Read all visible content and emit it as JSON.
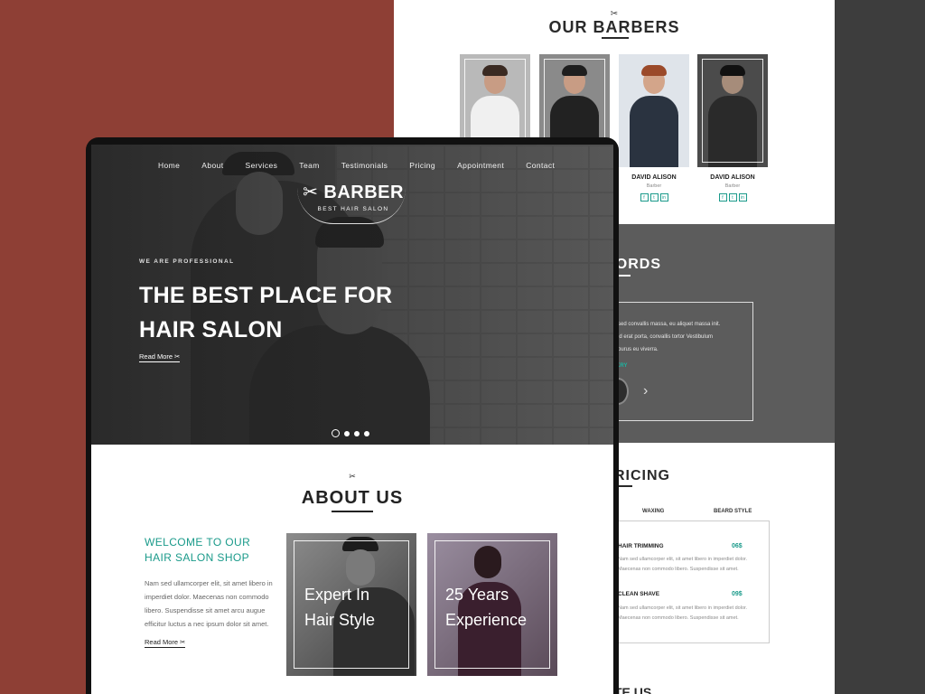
{
  "colors": {
    "accent": "#1a9a8a",
    "brick_bg": "#8e3f35",
    "dark": "#222222"
  },
  "back_page": {
    "scissors_icon": "✂",
    "barbers_title": "OUR BARBERS",
    "barbers": [
      {
        "name": "",
        "role": ""
      },
      {
        "name": "",
        "role": ""
      },
      {
        "name": "DAVID ALISON",
        "role": "Barber",
        "social": [
          "f",
          "t",
          "in"
        ]
      },
      {
        "name": "DAVID ALISON",
        "role": "Barber",
        "social": [
          "f",
          "t",
          "in"
        ]
      }
    ],
    "testimonials_title": "RS WORDS",
    "testimonial_lines": [
      "sed convallis massa, eu aliquet massa init.",
      "id erat porta, convallis tortor Vestibulum",
      "purus eu viverra."
    ],
    "testimonial_name": "KRY",
    "next_arrow": "›",
    "pricing_title": "RICING",
    "pricing_tabs": [
      "WAXING",
      "BEARD STYLE"
    ],
    "pricing_items": [
      {
        "name": "HAIR TRIMMING",
        "price": "06$",
        "desc1": "Nam sed ullamcorper elit, sit amet libero in imperdiet dolor.",
        "desc2": "Maecenas non commodo libero. Suspendisse sit amet."
      },
      {
        "name": "CLEAN SHAVE",
        "price": "09$",
        "desc1": "Nam sed ullamcorper elit, sit amet libero in imperdiet dolor.",
        "desc2": "Maecenas non commodo libero. Suspendisse sit amet."
      }
    ],
    "contact_peek": "TE US"
  },
  "hero": {
    "nav": [
      "Home",
      "About",
      "Services",
      "Team",
      "Testimonials",
      "Pricing",
      "Appointment",
      "Contact"
    ],
    "logo_brand": "✂ BARBER",
    "logo_tagline": "BEST HAIR SALON",
    "eyebrow": "WE ARE PROFESSIONAL",
    "headline_1": "THE BEST PLACE FOR",
    "headline_2": "HAIR SALON",
    "read_more": "Read More ✂"
  },
  "about": {
    "scissors_icon": "✂",
    "title": "ABOUT US",
    "welcome": "WELCOME TO OUR HAIR SALON SHOP",
    "body": "Nam sed ullamcorper elit, sit amet libero in imperdiet dolor. Maecenas non commodo libero. Suspendisse sit amet arcu augue efficitur luctus a nec ipsum dolor sit amet.",
    "read_more": "Read More ✂",
    "cards": [
      {
        "line1": "Expert In",
        "line2": "Hair Style"
      },
      {
        "line1": "25 Years",
        "line2": "Experience"
      }
    ]
  }
}
